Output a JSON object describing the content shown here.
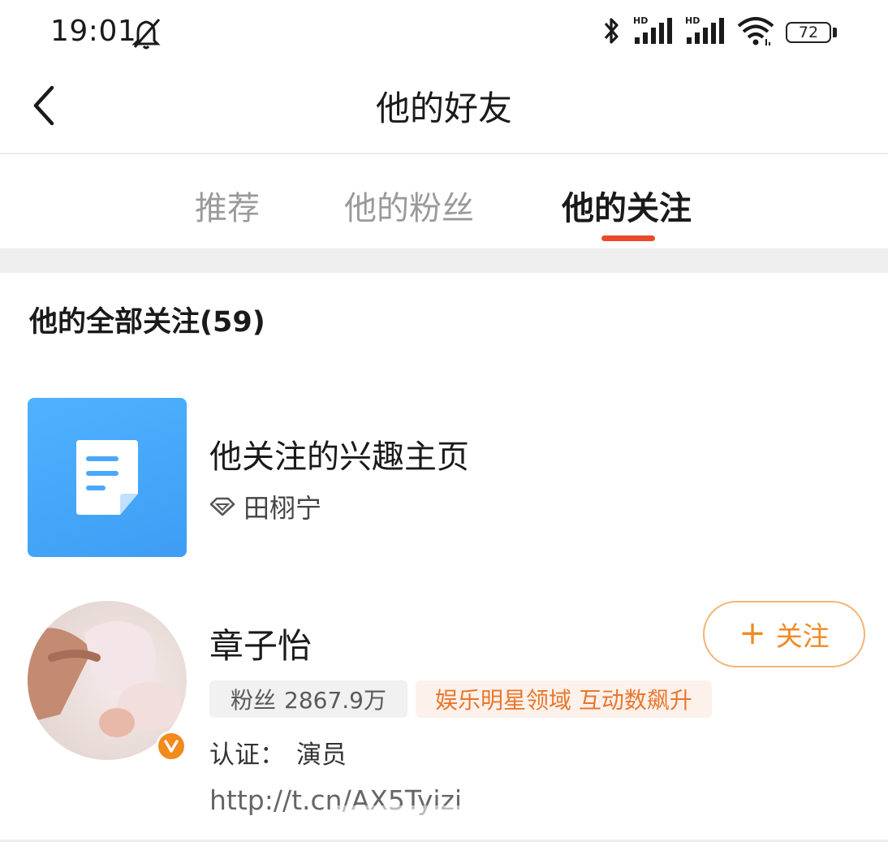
{
  "status_bar": {
    "time": "19:01",
    "battery": "72",
    "icons": [
      "mute-icon",
      "bluetooth-icon",
      "signal-hd-icon",
      "signal-hd-icon",
      "wifi-icon",
      "battery-icon"
    ]
  },
  "header": {
    "title": "他的好友"
  },
  "tabs": [
    {
      "label": "推荐",
      "active": false
    },
    {
      "label": "他的粉丝",
      "active": false
    },
    {
      "label": "他的关注",
      "active": true
    }
  ],
  "colors": {
    "accent": "#e84a2a",
    "follow": "#f08a25",
    "verified": "#f28a1c",
    "thumb_blue": "#3e9df3"
  },
  "section": {
    "title": "他的全部关注(59)"
  },
  "interest_item": {
    "title": "他关注的兴趣主页",
    "subtitle": "田栩宁",
    "icon": "document-icon"
  },
  "user_item": {
    "name": "章子怡",
    "follow_label": "关注",
    "fans_label": "粉丝",
    "fans_count": "2867.9万",
    "promo": "娱乐明星领域 互动数飙升",
    "cert_label": "认证：",
    "cert_value": "演员",
    "link": "http://t.cn/AX5Tyizi"
  }
}
